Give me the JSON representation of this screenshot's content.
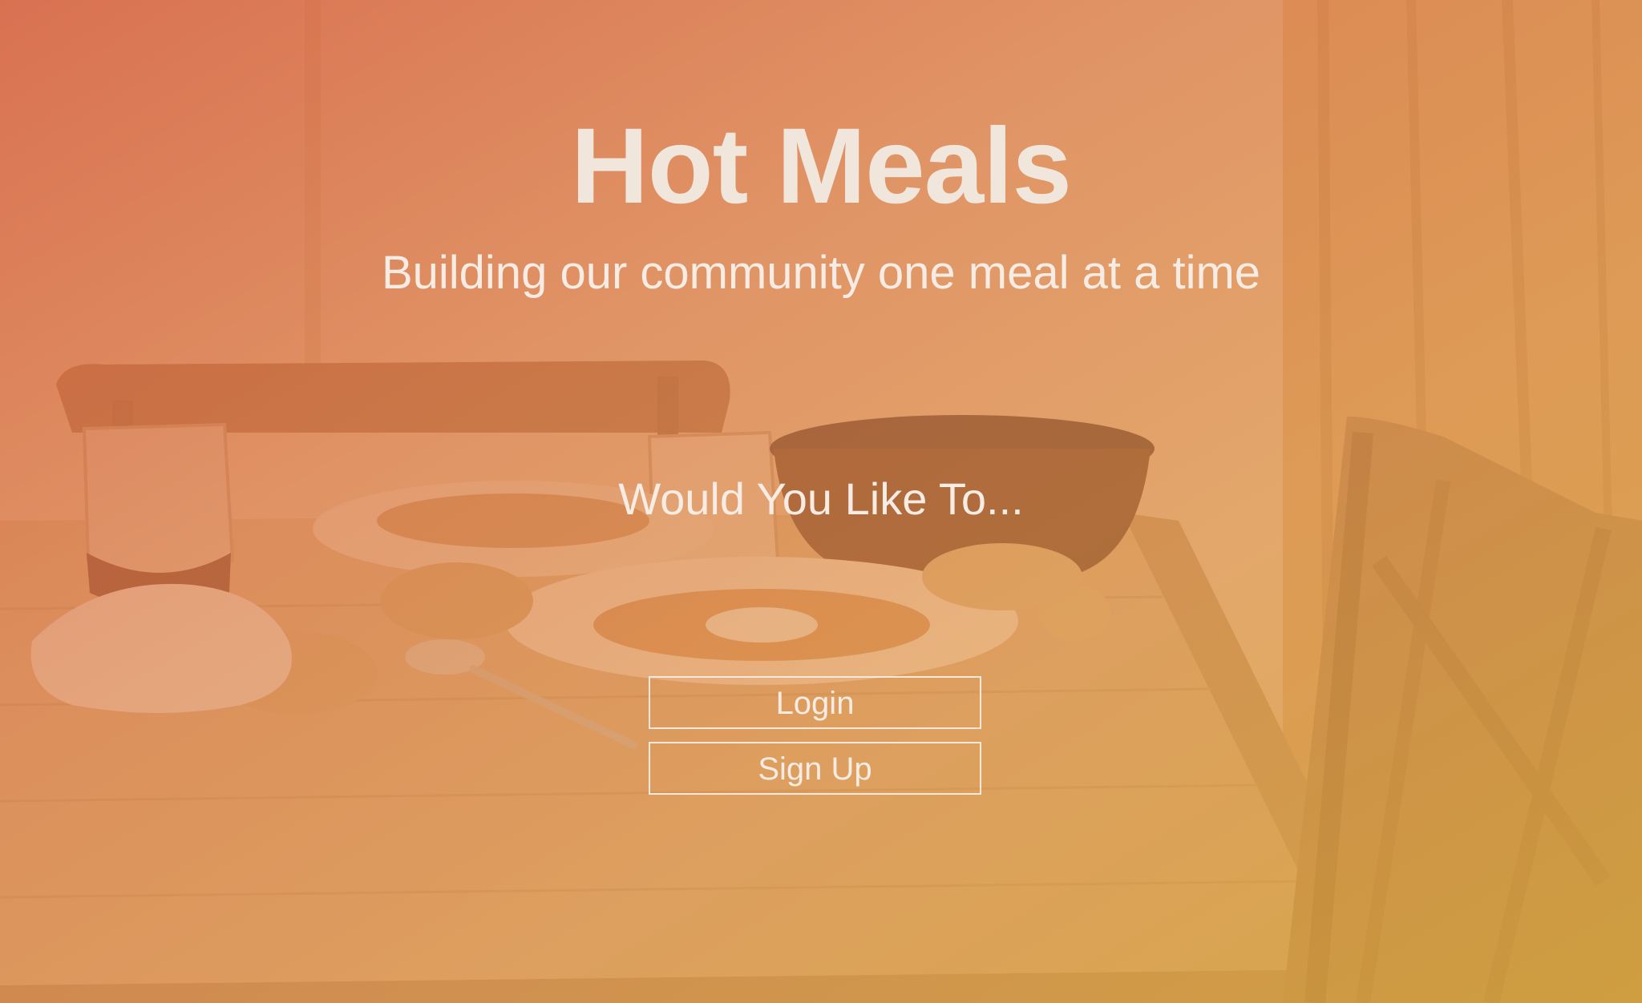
{
  "hero": {
    "title": "Hot Meals",
    "tagline": "Building our community one meal at a time",
    "prompt": "Would You Like To...",
    "login_label": "Login",
    "signup_label": "Sign Up"
  },
  "background": {
    "image": "dining-table-photo",
    "overlay_colors": [
      "#d66042",
      "#de804e",
      "#e29c50",
      "#d6a83e"
    ]
  }
}
